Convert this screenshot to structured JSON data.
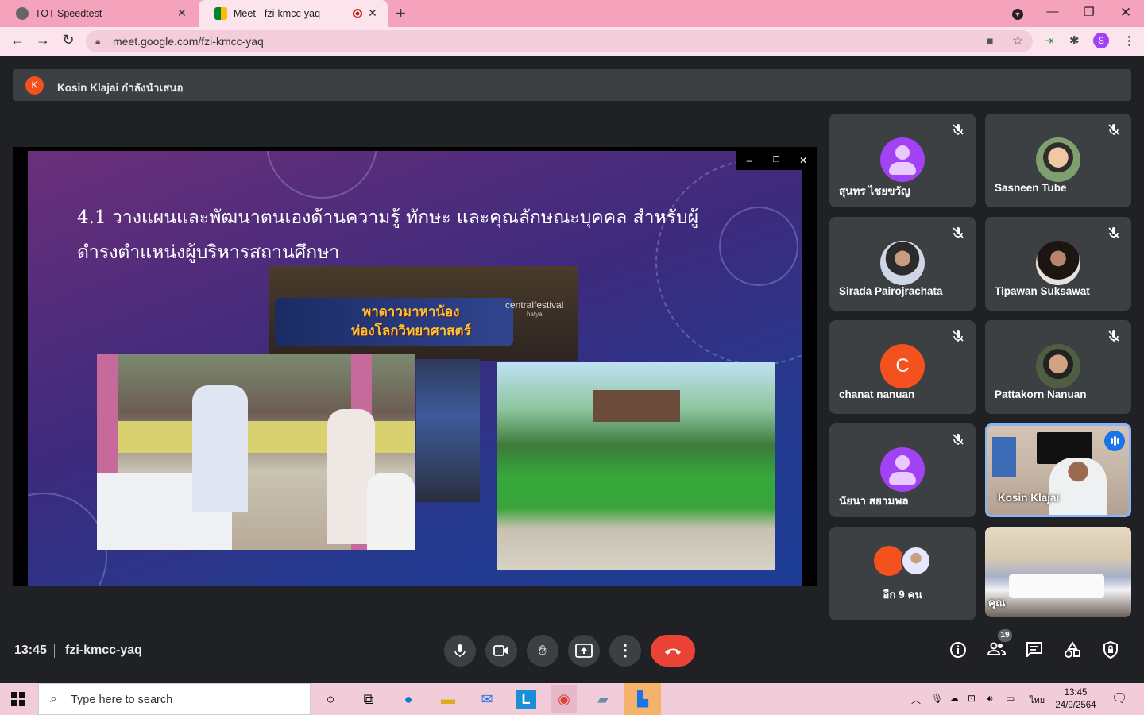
{
  "browser": {
    "tabs": [
      {
        "title": "TOT Speedtest",
        "active": false
      },
      {
        "title": "Meet - fzi-kmcc-yaq",
        "active": true
      }
    ],
    "url": "meet.google.com/fzi-kmcc-yaq",
    "profile_initial": "S",
    "accent_color": "#f5a3bc"
  },
  "banner": {
    "avatar_initial": "K",
    "text": "Kosin Klajai กำลังนำเสนอ"
  },
  "slide": {
    "title": "4.1 วางแผนและพัฒนาตนเองด้านความรู้ ทักษะ และคุณลักษณะบุคคล สำหรับผู้ดำรงตำแหน่งผู้บริหารสถานศึกษา",
    "banner_line1": "พาดาวมาหาน้อง",
    "banner_line2": "ท่องโลกวิทยาศาสตร์",
    "brand": "centralfestival",
    "brand_sub": "hatyai"
  },
  "participants": [
    {
      "name": "สุนทร ไชยขวัญ",
      "muted": true,
      "avatar": "person-icon"
    },
    {
      "name": "Sasneen Tube",
      "muted": true,
      "avatar": "photo"
    },
    {
      "name": "Sirada Pairojrachata",
      "muted": true,
      "avatar": "photo"
    },
    {
      "name": "Tipawan Suksawat",
      "muted": true,
      "avatar": "photo"
    },
    {
      "name": "chanat nanuan",
      "muted": true,
      "avatar_letter": "C",
      "avatar_color": "#f4511e"
    },
    {
      "name": "Pattakorn Nanuan",
      "muted": true,
      "avatar": "photo"
    },
    {
      "name": "นัยนา สยามพล",
      "muted": true,
      "avatar": "person-icon"
    },
    {
      "name": "Kosin Klajai",
      "muted": false,
      "speaking": true,
      "video": true
    },
    {
      "name": "อีก 9 คน"
    },
    {
      "name": "คุณ",
      "video": true
    }
  ],
  "meeting": {
    "time": "13:45",
    "code": "fzi-kmcc-yaq",
    "people_count": "19",
    "hangup_color": "#ea4335",
    "speaking_color": "#1a73e8"
  },
  "taskbar": {
    "search_placeholder": "Type here to search",
    "lang": "ไทย",
    "time": "13:45",
    "date": "24/9/2564"
  }
}
